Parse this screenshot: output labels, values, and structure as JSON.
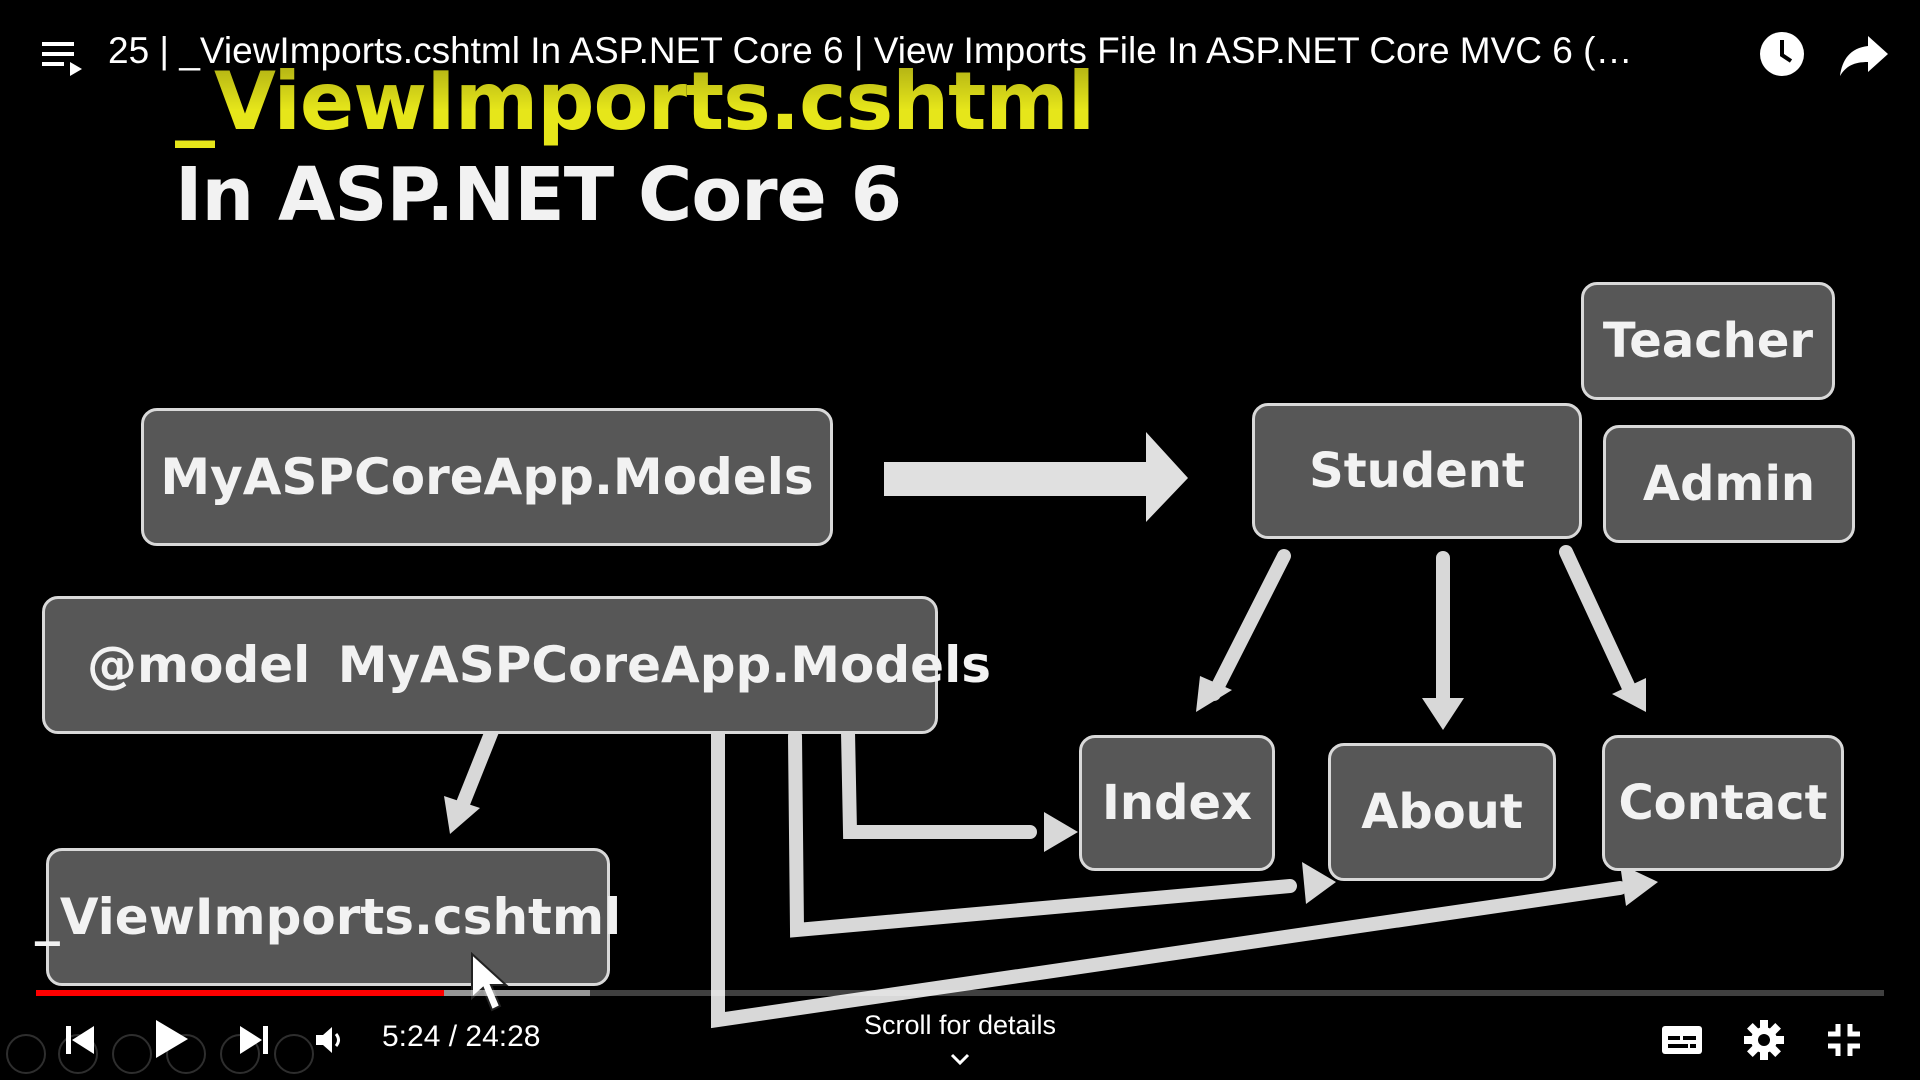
{
  "video": {
    "title": "25 | _ViewImports.cshtml In ASP.NET Core 6 | View Imports File In ASP.NET Core MVC 6 (…",
    "current_time": "5:24",
    "duration": "24:28",
    "time_label": "5:24 / 24:28",
    "progress_fraction": 0.221,
    "buffered_fraction": 0.3,
    "scroll_hint": "Scroll for details"
  },
  "slide": {
    "title_line1": "_ViewImports.cshtml",
    "title_line2": "In ASP.NET Core 6",
    "boxes": {
      "models": "MyASPCoreApp.Models",
      "at_model": "@model  MyASPCoreApp.Models",
      "view_imports": "_ViewImports.cshtml",
      "student": "Student",
      "teacher": "Teacher",
      "admin": "Admin",
      "index": "Index",
      "about": "About",
      "contact": "Contact"
    }
  },
  "icons": {
    "playlist": "playlist-icon",
    "watch_later": "clock-icon",
    "share": "share-icon",
    "previous": "skip-previous-icon",
    "play": "play-icon",
    "next": "skip-next-icon",
    "volume": "volume-icon",
    "subtitles": "subtitles-icon",
    "settings": "gear-icon",
    "exit_fullscreen": "exit-fullscreen-icon"
  },
  "colors": {
    "progress_played": "#ff0000",
    "title_accent": "#e6e61a",
    "box_fill": "#575757"
  }
}
